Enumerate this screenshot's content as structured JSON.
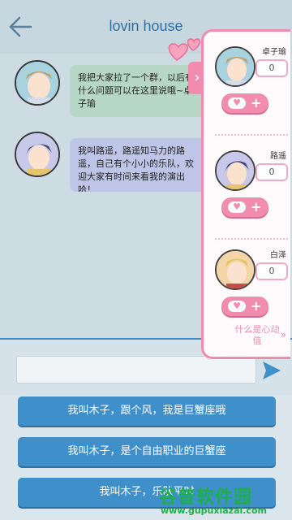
{
  "header": {
    "title": "lovin house"
  },
  "chat": {
    "messages": [
      {
        "text": "我把大家拉了一个群，以后有什么问题可以在这里说哦~卓子瑜",
        "bubble_color": "#b6d7c5"
      },
      {
        "text": "我叫路遥，路遥知马力的路遥，自己有个小小的乐队，欢迎大家有时间来看我的演出哈！",
        "bubble_color": "#bfc5e6"
      }
    ]
  },
  "input": {
    "value": "",
    "send_icon": "send-icon"
  },
  "options": [
    {
      "label": "我叫木子，跟个风，我是巨蟹座哦"
    },
    {
      "label": "我叫木子，是个自由职业的巨蟹座"
    },
    {
      "label": "我叫木子，乐队平时"
    }
  ],
  "panel": {
    "characters": [
      {
        "name": "卓子瑜",
        "score": "0"
      },
      {
        "name": "路遥",
        "score": "0"
      },
      {
        "name": "白泽",
        "score": "0"
      }
    ],
    "info_link": "什么是心动值",
    "accent_color": "#f28cae"
  },
  "watermark": {
    "title": "谷普软件园",
    "url": "www.gupuxiazai.com"
  }
}
